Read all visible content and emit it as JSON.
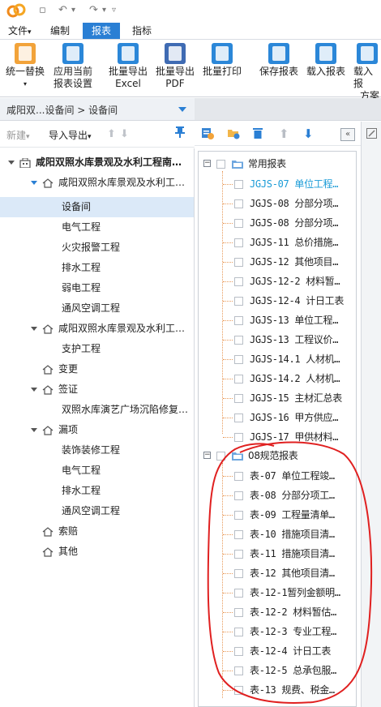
{
  "titlebar": {
    "quick_access": [
      "▫",
      "↶",
      "▾",
      "↷",
      "▾",
      "▿"
    ]
  },
  "menubar": {
    "tabs": [
      {
        "label": "文件",
        "arrow": "▾"
      },
      {
        "label": "编制"
      },
      {
        "label": "报表",
        "active": true
      },
      {
        "label": "指标"
      }
    ]
  },
  "ribbon": {
    "buttons": [
      {
        "line1": "统一替换",
        "line2": "▾",
        "icon": "replace-icon",
        "color": "#f2a33a"
      },
      {
        "line1": "应用当前",
        "line2": "报表设置",
        "icon": "apply-settings-icon",
        "color": "#2b87d8"
      },
      {
        "line1": "批量导出",
        "line2": "Excel",
        "icon": "excel-export-icon",
        "color": "#2b87d8"
      },
      {
        "line1": "批量导出",
        "line2": "PDF",
        "icon": "pdf-export-icon",
        "color": "#2b87d8"
      },
      {
        "line1": "批量打印",
        "line2": "",
        "icon": "print-icon",
        "color": "#2b87d8"
      },
      {
        "line1": "保存报表",
        "line2": "",
        "icon": "save-report-icon",
        "color": "#2b87d8"
      },
      {
        "line1": "载入报表",
        "line2": "",
        "icon": "load-report-icon",
        "color": "#2b87d8"
      },
      {
        "line1": "载入报",
        "line2": "方案",
        "icon": "load-scheme-icon",
        "color": "#2b87d8"
      }
    ]
  },
  "breadcrumb": {
    "text": "咸阳双...设备间 > 设备间"
  },
  "left_toolbar": {
    "new_label": "新建",
    "new_arrow": "▾",
    "import_export_label": "导入导出",
    "import_export_arrow": "▾",
    "up": "⬆",
    "down": "⬇"
  },
  "project_tree": [
    {
      "label": "咸阳双照水库景观及水利工程南…",
      "level": 0,
      "type": "building",
      "expanded": true,
      "bold": true
    },
    {
      "label": "咸阳双照水库景观及水利工…",
      "level": 1,
      "type": "house",
      "expanded": true,
      "blue_caret": true
    },
    {
      "label": "设备间",
      "level": 2,
      "type": "leaf",
      "selected": true
    },
    {
      "label": "电气工程",
      "level": 2,
      "type": "leaf"
    },
    {
      "label": "火灾报警工程",
      "level": 2,
      "type": "leaf"
    },
    {
      "label": "排水工程",
      "level": 2,
      "type": "leaf"
    },
    {
      "label": "弱电工程",
      "level": 2,
      "type": "leaf"
    },
    {
      "label": "通风空调工程",
      "level": 2,
      "type": "leaf"
    },
    {
      "label": "咸阳双照水库景观及水利工…",
      "level": 1,
      "type": "house",
      "expanded": true
    },
    {
      "label": "支护工程",
      "level": 2,
      "type": "leaf"
    },
    {
      "label": "变更",
      "level": 1,
      "type": "house",
      "expanded": false
    },
    {
      "label": "签证",
      "level": 1,
      "type": "house",
      "expanded": true
    },
    {
      "label": "双照水库演艺广场沉陷修复…",
      "level": 2,
      "type": "leaf"
    },
    {
      "label": "漏项",
      "level": 1,
      "type": "house",
      "expanded": true
    },
    {
      "label": "装饰装修工程",
      "level": 2,
      "type": "leaf"
    },
    {
      "label": "电气工程",
      "level": 2,
      "type": "leaf"
    },
    {
      "label": "排水工程",
      "level": 2,
      "type": "leaf"
    },
    {
      "label": "通风空调工程",
      "level": 2,
      "type": "leaf"
    },
    {
      "label": "索赔",
      "level": 1,
      "type": "house",
      "expanded": false
    },
    {
      "label": "其他",
      "level": 1,
      "type": "house",
      "expanded": false
    }
  ],
  "report_toolbar": {
    "collapse": "«"
  },
  "report_groups": [
    {
      "label": "常用报表",
      "items": [
        {
          "label": "JGJS-07 单位工程…",
          "highlight": true
        },
        {
          "label": "JGJS-08 分部分项…"
        },
        {
          "label": "JGJS-08 分部分项…"
        },
        {
          "label": "JGJS-11 总价措施…"
        },
        {
          "label": "JGJS-12 其他项目…"
        },
        {
          "label": "JGJS-12-2 材料暂…"
        },
        {
          "label": "JGJS-12-4 计日工表"
        },
        {
          "label": "JGJS-13 单位工程…"
        },
        {
          "label": "JGJS-13 工程议价…"
        },
        {
          "label": "JGJS-14.1 人材机…"
        },
        {
          "label": "JGJS-14.2 人材机…"
        },
        {
          "label": "JGJS-15 主材汇总表"
        },
        {
          "label": "JGJS-16 甲方供应…"
        },
        {
          "label": "JGJS-17 甲供材料…"
        }
      ]
    },
    {
      "label": "08规范报表",
      "items": [
        {
          "label": "表-07 单位工程竣…"
        },
        {
          "label": "表-08 分部分项工…"
        },
        {
          "label": "表-09 工程量清单…"
        },
        {
          "label": "表-10 措施项目清…"
        },
        {
          "label": "表-11 措施项目清…"
        },
        {
          "label": "表-12 其他项目清…"
        },
        {
          "label": "表-12-1暂列金额明…"
        },
        {
          "label": "表-12-2 材料暂估…"
        },
        {
          "label": "表-12-3 专业工程…"
        },
        {
          "label": "表-12-4 计日工表"
        },
        {
          "label": "表-12-5 总承包服…"
        },
        {
          "label": "表-13 规费、税金…"
        }
      ]
    }
  ],
  "colors": {
    "accent": "#2a7fd4",
    "highlight_text": "#1a9bd7",
    "annotation": "#e02020"
  }
}
